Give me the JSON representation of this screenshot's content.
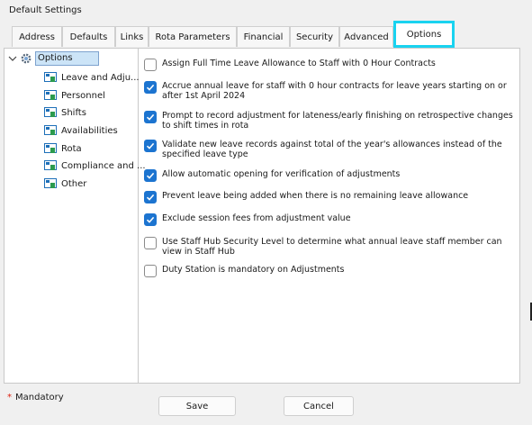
{
  "window": {
    "title": "Default Settings"
  },
  "tabs": [
    {
      "label": "Address"
    },
    {
      "label": "Defaults"
    },
    {
      "label": "Links"
    },
    {
      "label": "Rota Parameters"
    },
    {
      "label": "Financial"
    },
    {
      "label": "Security"
    },
    {
      "label": "Advanced"
    },
    {
      "label": "Options",
      "active": true
    }
  ],
  "tree": {
    "root": {
      "label": "Options",
      "icon": "gear-icon"
    },
    "items": [
      {
        "label": "Leave and Adju...",
        "icon": "node-icon"
      },
      {
        "label": "Personnel",
        "icon": "node-icon"
      },
      {
        "label": "Shifts",
        "icon": "node-icon"
      },
      {
        "label": "Availabilities",
        "icon": "node-icon"
      },
      {
        "label": "Rota",
        "icon": "node-icon"
      },
      {
        "label": "Compliance and ...",
        "icon": "node-icon"
      },
      {
        "label": "Other",
        "icon": "node-icon"
      }
    ]
  },
  "options": [
    {
      "label": "Assign Full Time Leave Allowance to Staff with 0 Hour Contracts",
      "checked": false
    },
    {
      "label": "Accrue annual leave for staff with 0 hour contracts for leave years starting on or after 1st April 2024",
      "checked": true
    },
    {
      "label": "Prompt to record adjustment for lateness/early finishing on retrospective changes to shift times in rota",
      "checked": true
    },
    {
      "label": "Validate new leave records against total of the year's allowances instead of the specified leave type",
      "checked": true
    },
    {
      "label": "Allow automatic opening for verification of adjustments",
      "checked": true
    },
    {
      "label": "Prevent leave being added when there is no remaining leave allowance",
      "checked": true
    },
    {
      "label": "Exclude session fees from adjustment value",
      "checked": true
    },
    {
      "label": "Use Staff Hub Security Level to determine what annual leave staff member can view in Staff Hub",
      "checked": false
    },
    {
      "label": "Duty Station is mandatory on Adjustments",
      "checked": false
    }
  ],
  "footer": {
    "mandatory_star": "*",
    "mandatory_label": "Mandatory",
    "save_label": "Save",
    "cancel_label": "Cancel"
  },
  "colors": {
    "accent": "#1c74d0",
    "highlight": "#19d3f0",
    "selection": "#cce4f7"
  }
}
